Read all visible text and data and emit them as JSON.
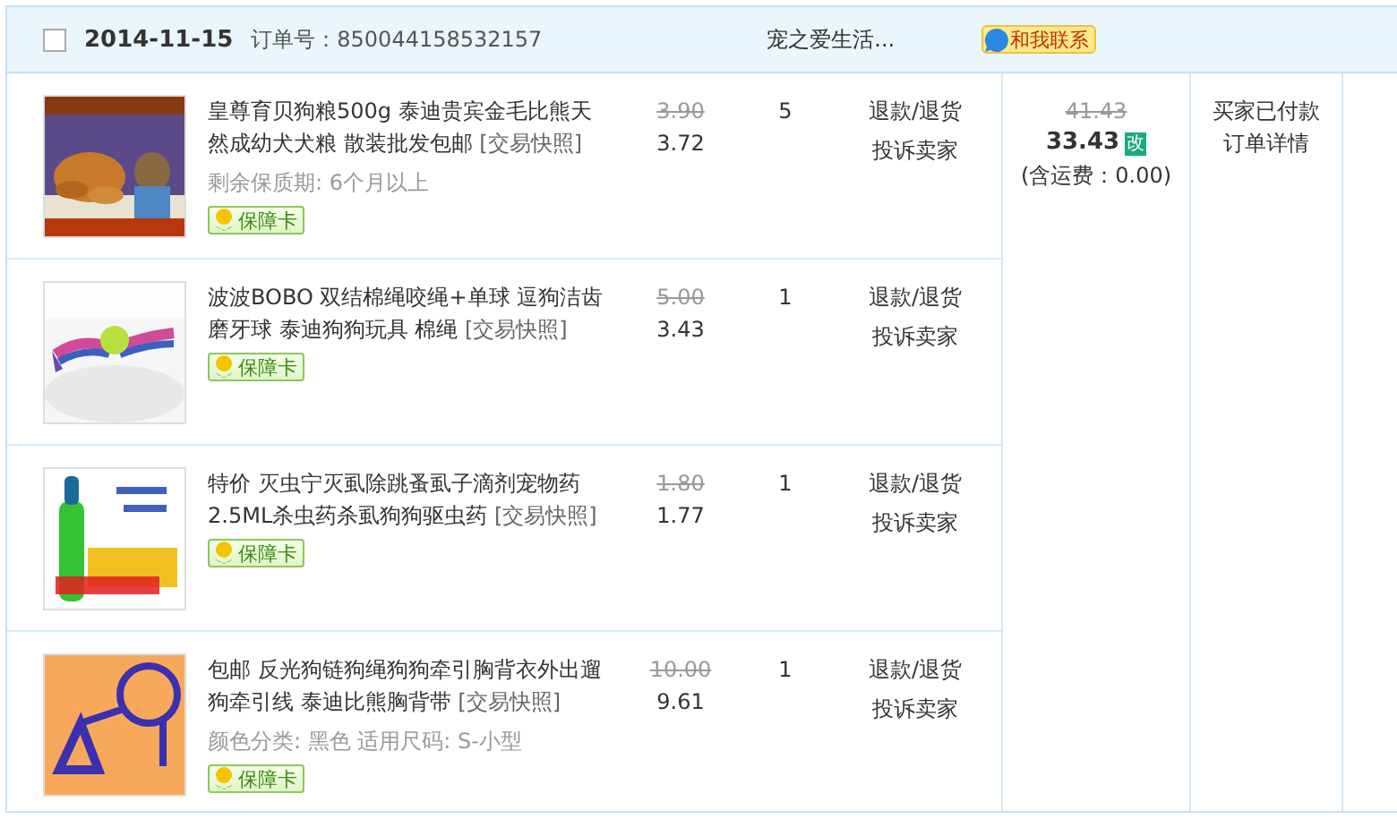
{
  "order": {
    "selected": false,
    "date": "2014-11-15",
    "order_no_label": "订单号：",
    "order_no": "850044158532157",
    "shop": "宠之爱生活...",
    "contact": "和我联系"
  },
  "items": [
    {
      "title": "皇尊育贝狗粮500g 泰迪贵宾金毛比熊天然成幼犬犬粮 散装批发包邮",
      "snapshot": "[交易快照]",
      "specs": "剩余保质期: 6个月以上",
      "guarantee": "保障卡",
      "original_price": "3.90",
      "price": "3.72",
      "quantity": "5",
      "actions": [
        "退款/退货",
        "投诉卖家"
      ]
    },
    {
      "title": "波波BOBO 双结棉绳咬绳+单球 逗狗洁齿磨牙球 泰迪狗狗玩具 棉绳",
      "snapshot": "[交易快照]",
      "guarantee": "保障卡",
      "original_price": "5.00",
      "price": "3.43",
      "quantity": "1",
      "actions": [
        "退款/退货",
        "投诉卖家"
      ]
    },
    {
      "title": "特价 灭虫宁灭虱除跳蚤虱子滴剂宠物药2.5ML杀虫药杀虱狗狗驱虫药",
      "snapshot": "[交易快照]",
      "guarantee": "保障卡",
      "original_price": "1.80",
      "price": "1.77",
      "quantity": "1",
      "actions": [
        "退款/退货",
        "投诉卖家"
      ]
    },
    {
      "title": "包邮 反光狗链狗绳狗狗牵引胸背衣外出遛狗牵引线 泰迪比熊胸背带",
      "snapshot": "[交易快照]",
      "specs": "颜色分类: 黑色  适用尺码: S-小型",
      "guarantee": "保障卡",
      "original_price": "10.00",
      "price": "9.61",
      "quantity": "1",
      "actions": [
        "退款/退货",
        "投诉卖家"
      ]
    }
  ],
  "total": {
    "original": "41.43",
    "amount": "33.43",
    "edit_badge": "改",
    "shipping": "(含运费：0.00)"
  },
  "status": {
    "text": "买家已付款",
    "link": "订单详情"
  }
}
